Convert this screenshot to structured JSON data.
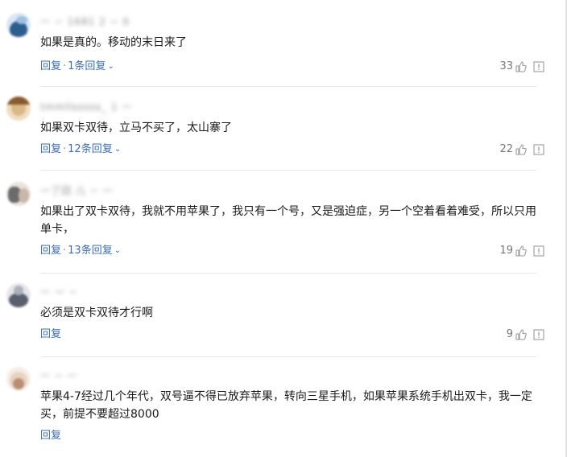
{
  "comments": [
    {
      "name": "一 ~ 1681 2 ~ 0",
      "text": "如果是真的。移动的末日来了",
      "reply_label": "回复",
      "sub_label": "1条回复",
      "likes": "33",
      "avatar_colors": [
        "#2c5d8f",
        "#9fc0e0",
        "#d8e7f5"
      ]
    },
    {
      "name": "tmmllsssss_ 1 一",
      "text": "如果双卡双待，立马不买了，太山寨了",
      "reply_label": "回复",
      "sub_label": "12条回复",
      "likes": "22",
      "avatar_colors": [
        "#d9b889",
        "#8a5a2e",
        "#f2dcc0"
      ]
    },
    {
      "name": "一了回 儿 ~ 一",
      "text": "如果出了双卡双待，我就不用苹果了，我只有一个号，又是强迫症，另一个空着看着难受，所以只用单卡，",
      "reply_label": "回复",
      "sub_label": "13条回复",
      "likes": "19",
      "avatar_colors": [
        "#6b6b6b",
        "#c8b6a6",
        "#e9e3dc"
      ]
    },
    {
      "name": "一 一 ~",
      "text": "必须是双卡双待才行啊",
      "reply_label": "回复",
      "sub_label": "",
      "likes": "9",
      "avatar_colors": [
        "#5a5f6b",
        "#aab1bb",
        "#e4e6ea"
      ]
    },
    {
      "name": "一 ~ 一",
      "text": "苹果4-7经过几个年代，双号逼不得已放弃苹果，转向三星手机，如果苹果系统手机出双卡，我一定买，前提不要超过8000",
      "reply_label": "回复",
      "sub_label": "",
      "likes": "",
      "avatar_colors": [
        "#b98e74",
        "#e7d3c2",
        "#f6ede5"
      ]
    }
  ],
  "colors": {
    "link": "#3a6db3",
    "muted": "#8a8a8a",
    "icon": "#9a9a9a",
    "divider": "#e9e9e9"
  },
  "icons": {
    "like": "thumbs-up-icon",
    "report": "report-icon",
    "expand": "chevron-down-icon"
  }
}
